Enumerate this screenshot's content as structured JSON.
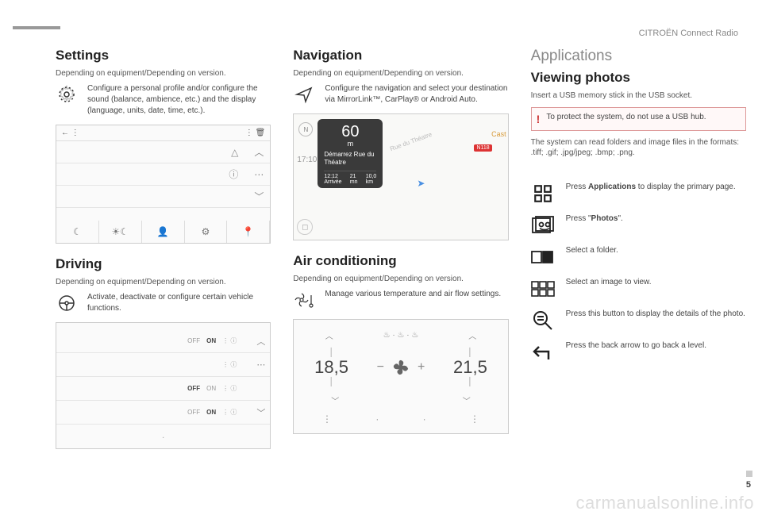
{
  "header": {
    "title": "CITROËN Connect Radio"
  },
  "col1": {
    "settings": {
      "heading": "Settings",
      "sub": "Depending on equipment/Depending on version.",
      "desc": "Configure a personal profile and/or configure the sound (balance, ambience, etc.) and the display (language, units, date, time, etc.)."
    },
    "driving": {
      "heading": "Driving",
      "sub": "Depending on equipment/Depending on version.",
      "desc": "Activate, deactivate or configure certain vehicle functions."
    },
    "driving_screenshot": {
      "off": "OFF",
      "on": "ON"
    }
  },
  "col2": {
    "navigation": {
      "heading": "Navigation",
      "sub": "Depending on equipment/Depending on version.",
      "desc": "Configure the navigation and select your destination via MirrorLink™, CarPlay® or Android Auto."
    },
    "nav_screenshot": {
      "distance": "60",
      "distance_unit": "m",
      "destination": "Démarrez Rue du Théatre",
      "eta_time": "12:12",
      "eta_time_label": "Arrivée",
      "eta_min": "21",
      "eta_min_label": "mn",
      "eta_km": "10,0",
      "eta_km_label": "km",
      "clock": "17:10",
      "road": "Rue du Théatre",
      "road_badge": "N118",
      "compass": "N",
      "poi": "Cast"
    },
    "ac": {
      "heading": "Air conditioning",
      "sub": "Depending on equipment/Depending on version.",
      "desc": "Manage various temperature and air flow settings."
    },
    "ac_screenshot": {
      "temp_left": "18,5",
      "temp_right": "21,5"
    }
  },
  "col3": {
    "apps_heading": "Applications",
    "viewing_heading": "Viewing photos",
    "insert": "Insert a USB memory stick in the USB socket.",
    "warning": "To protect the system, do not use a USB hub.",
    "formats": "The system can read folders and image files in the formats: .tiff; .gif; .jpg/jpeg; .bmp; .png.",
    "steps": {
      "apps_pre": "Press ",
      "apps_bold": "Applications",
      "apps_post": " to display the primary page.",
      "photos_pre": "Press \"",
      "photos_bold": "Photos",
      "photos_post": "\".",
      "folder": "Select a folder.",
      "image": "Select an image to view.",
      "details": "Press this button to display the details of the photo.",
      "back": "Press the back arrow to go back a level."
    }
  },
  "page_number": "5",
  "watermark": "carmanualsonline.info"
}
